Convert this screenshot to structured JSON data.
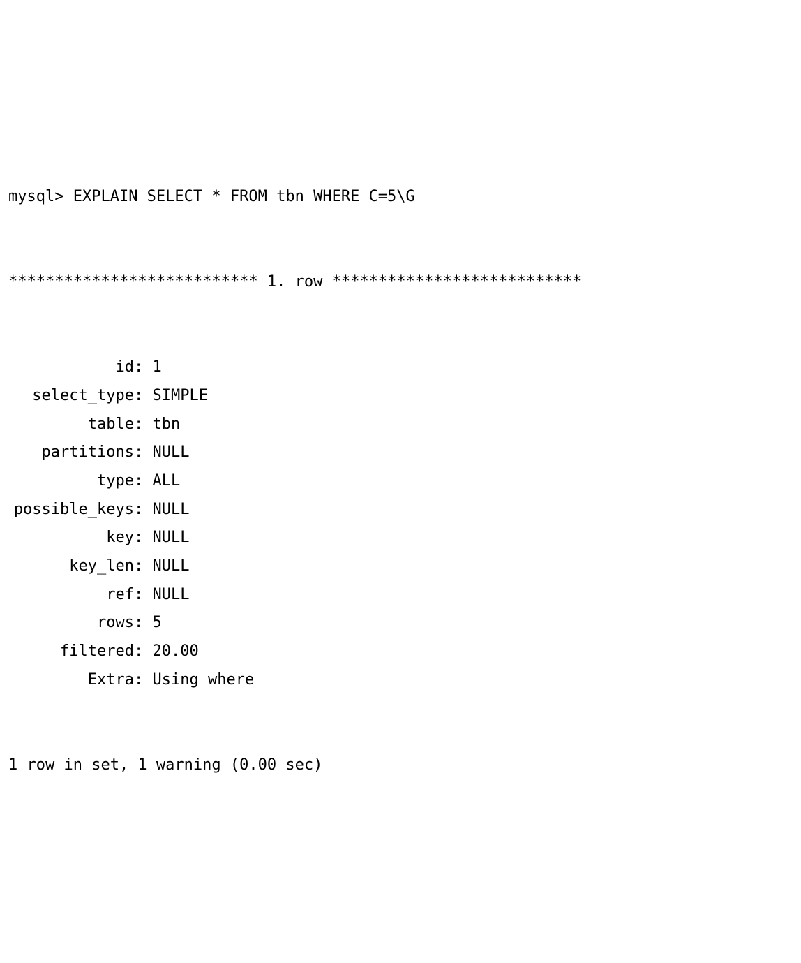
{
  "prompt": "mysql> ",
  "command": "EXPLAIN SELECT * FROM tbn WHERE C=5\\G",
  "separator": "*************************** 1. row ***************************",
  "fields": [
    {
      "label": "id",
      "value": "1"
    },
    {
      "label": "select_type",
      "value": "SIMPLE"
    },
    {
      "label": "table",
      "value": "tbn"
    },
    {
      "label": "partitions",
      "value": "NULL"
    },
    {
      "label": "type",
      "value": "ALL"
    },
    {
      "label": "possible_keys",
      "value": "NULL"
    },
    {
      "label": "key",
      "value": "NULL"
    },
    {
      "label": "key_len",
      "value": "NULL"
    },
    {
      "label": "ref",
      "value": "NULL"
    },
    {
      "label": "rows",
      "value": "5"
    },
    {
      "label": "filtered",
      "value": "20.00"
    },
    {
      "label": "Extra",
      "value": "Using where"
    }
  ],
  "footer": "1 row in set, 1 warning (0.00 sec)"
}
